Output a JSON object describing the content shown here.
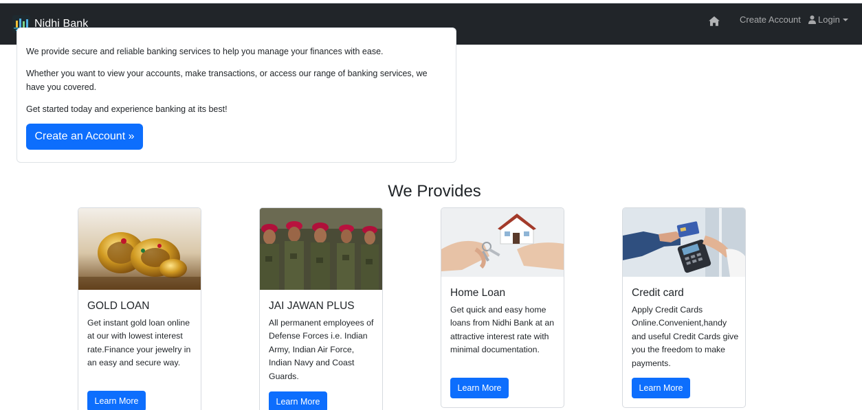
{
  "navbar": {
    "brand_name": "Nidhi Bank",
    "home_icon": "home-icon",
    "create_account_label": "Create Account",
    "login_label": "Login",
    "background": "#212529"
  },
  "hero": {
    "paragraph_1": "We provide secure and reliable banking services to help you manage your finances with ease.",
    "paragraph_2": "Whether you want to view your accounts, make transactions, or access our range of banking services, we have you covered.",
    "paragraph_3": "Get started today and experience banking at its best!",
    "button_label": "Create an Account »"
  },
  "services": {
    "title": "We Provides",
    "cards": [
      {
        "title": "GOLD LOAN",
        "text": "Get instant gold loan online at our with lowest interest rate.Finance your jewelry in an easy and secure way.",
        "button_label": "Learn More",
        "image": "gold-jewelry-image"
      },
      {
        "title": "JAI JAWAN PLUS",
        "text": "All permanent employees of Defense Forces i.e. Indian Army, Indian Air Force, Indian Navy and Coast Guards.",
        "button_label": "Learn More",
        "image": "soldiers-image"
      },
      {
        "title": "Home Loan",
        "text": "Get quick and easy home loans from Nidhi Bank at an attractive interest rate with minimal documentation.",
        "button_label": "Learn More",
        "image": "house-keys-image"
      },
      {
        "title": "Credit card",
        "text": "Apply Credit Cards Online.Convenient,handy and useful Credit Cards give you the freedom to make payments.",
        "button_label": "Learn More",
        "image": "card-payment-image"
      }
    ]
  },
  "colors": {
    "primary": "#0d6efd",
    "navbar": "#212529"
  }
}
